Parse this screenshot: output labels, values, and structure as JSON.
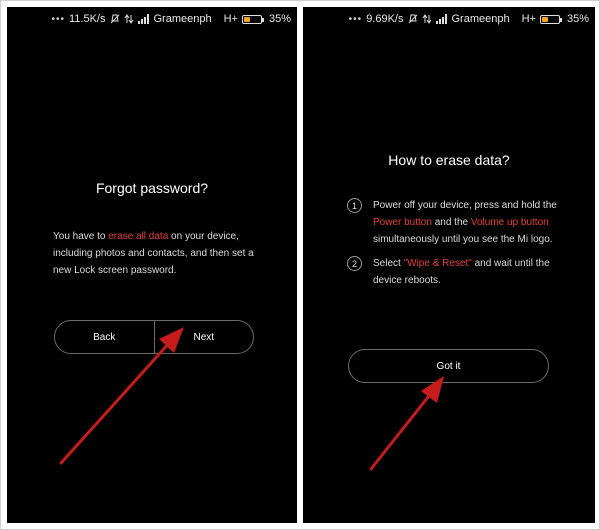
{
  "left_screen": {
    "status": {
      "speed": "11.5K/s",
      "carrier": "Grameenph",
      "network": "H+",
      "battery": "35%",
      "battery_level_percent": 35
    },
    "title": "Forgot password?",
    "description": {
      "part1": "You have to ",
      "highlight": "erase all data",
      "part2": " on your device, including photos and contacts, and then set a new Lock screen password."
    },
    "buttons": {
      "back": "Back",
      "next": "Next"
    }
  },
  "right_screen": {
    "status": {
      "speed": "9.69K/s",
      "carrier": "Grameenph",
      "network": "H+",
      "battery": "35%",
      "battery_level_percent": 35
    },
    "title": "How to erase data?",
    "steps": [
      {
        "num": "1",
        "t1": "Power off your device, press and hold the ",
        "h1": "Power button",
        "t2": " and the ",
        "h2": "Volume up button",
        "t3": " simultaneously until you see the Mi logo."
      },
      {
        "num": "2",
        "t1": "Select ",
        "h1": "\"Wipe & Reset\"",
        "t2": " and wait until the device reboots."
      }
    ],
    "button": "Got it"
  },
  "colors": {
    "highlight": "#e2423c",
    "arrow": "#c81b1b",
    "background": "#000000",
    "battery": "#f5a623"
  },
  "icons": [
    "dots-icon",
    "mute-icon",
    "data-arrows-icon",
    "signal-icon",
    "battery-icon",
    "pointer-arrow-icon"
  ]
}
